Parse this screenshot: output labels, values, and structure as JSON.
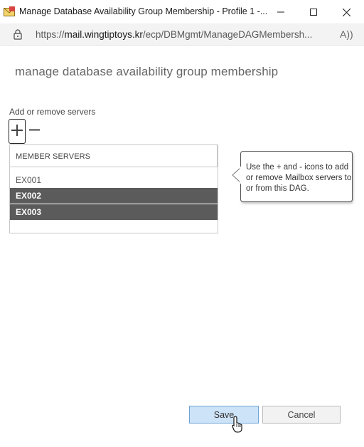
{
  "window": {
    "title": "Manage Database Availability Group Membership - Profile 1 -...",
    "app_icon": "envelope-icon",
    "controls": [
      "minimize-icon",
      "maximize-icon",
      "close-icon"
    ]
  },
  "address_bar": {
    "url_prefix": "https://",
    "url_host": "mail.wingtiptoys.kr",
    "url_path": "/ecp/DBMgmt/ManageDAGMembersh...",
    "lock_icon": "lock-icon",
    "read_aloud_icon": "A))"
  },
  "page": {
    "title": "manage database availability group membership",
    "section_label": "Add or remove servers"
  },
  "toolbar": {
    "add_icon": "plus-icon",
    "remove_icon": "minus-icon"
  },
  "member_table": {
    "header": "MEMBER SERVERS",
    "rows": [
      {
        "name": "EX001",
        "selected": false
      },
      {
        "name": "EX002",
        "selected": true
      },
      {
        "name": "EX003",
        "selected": true
      }
    ]
  },
  "tooltip": {
    "text": "Use the + and - icons to add or remove Mailbox servers to or from this DAG."
  },
  "buttons": {
    "save": "Save",
    "cancel": "Cancel"
  },
  "colors": {
    "selected_row": "#5b5b5b",
    "save_button_bg": "#cde3f7",
    "save_button_border": "#6ea4d6"
  }
}
